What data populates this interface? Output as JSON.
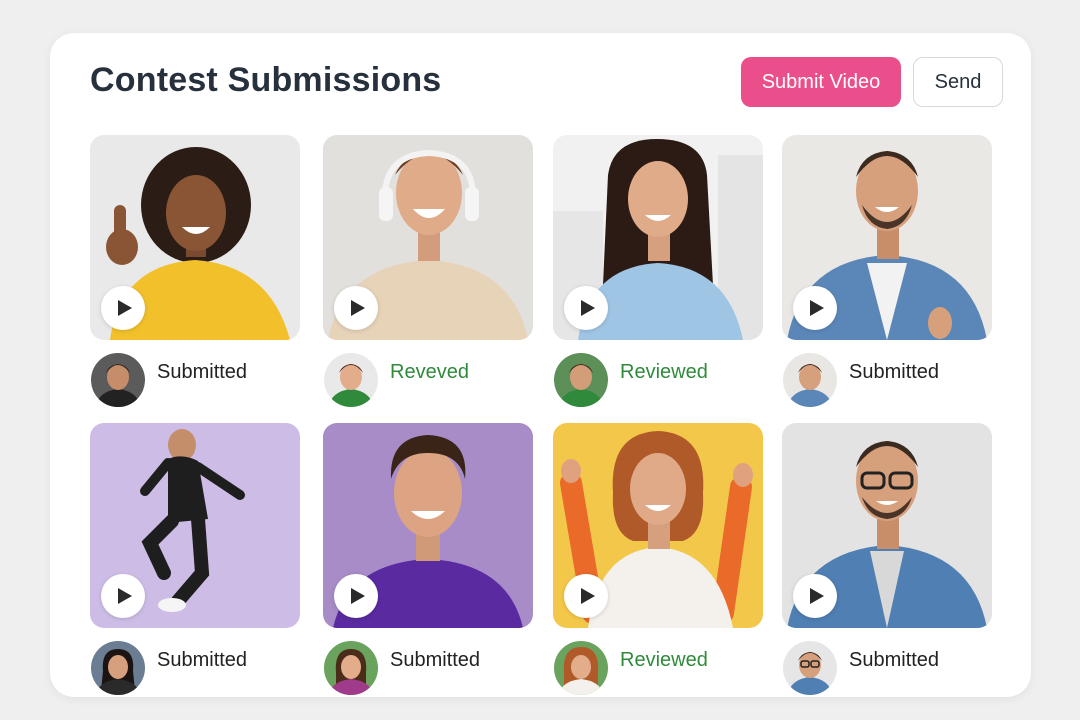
{
  "header": {
    "title": "Contest Submissions",
    "submit_label": "Submit Video",
    "send_label": "Send"
  },
  "colors": {
    "accent": "#ea4f8b",
    "reviewed": "#2f8a3b",
    "text": "#27313d"
  },
  "submissions": [
    {
      "status": "Submitted",
      "reviewed": false
    },
    {
      "status": "Reveved",
      "reviewed": true
    },
    {
      "status": "Reviewed",
      "reviewed": true
    },
    {
      "status": "Submitted",
      "reviewed": false
    },
    {
      "status": "Submitted",
      "reviewed": false
    },
    {
      "status": "Submitted",
      "reviewed": false
    },
    {
      "status": "Reviewed",
      "reviewed": true
    },
    {
      "status": "Submitted",
      "reviewed": false
    }
  ]
}
